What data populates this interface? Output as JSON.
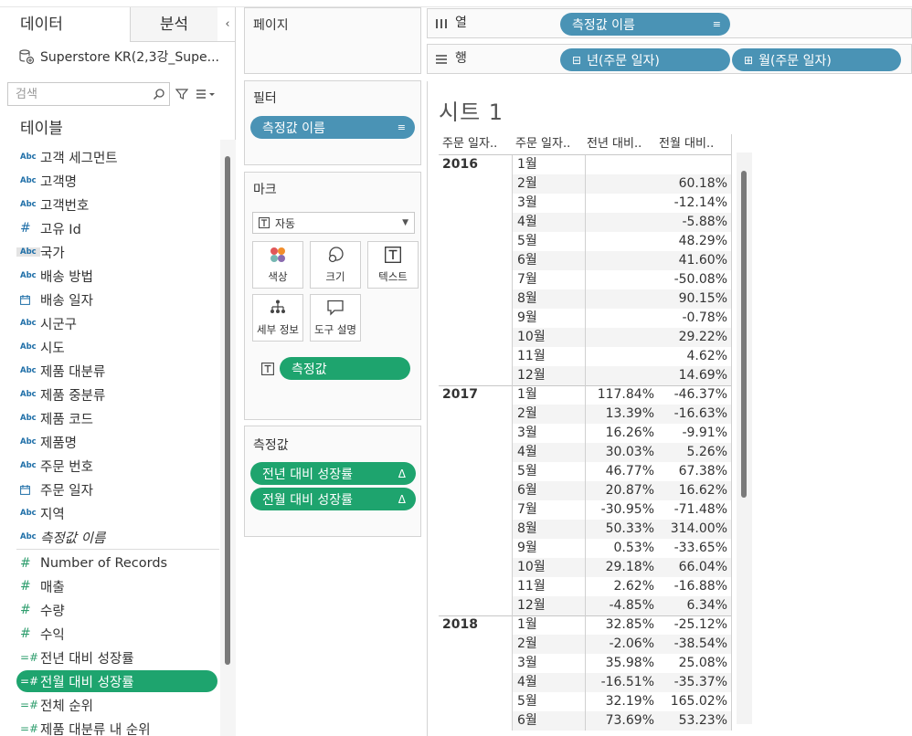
{
  "data_pane": {
    "tab_data": "데이터",
    "tab_analysis": "분석",
    "collapse_glyph": "‹",
    "source_name": "Superstore KR(2,3강_Supe...",
    "search_placeholder": "검색",
    "tables_title": "테이블",
    "dimensions": [
      {
        "type": "Abc",
        "name": "고객 세그먼트"
      },
      {
        "type": "Abc",
        "name": "고객명"
      },
      {
        "type": "Abc",
        "name": "고객번호"
      },
      {
        "type": "#",
        "name": "고유 Id"
      },
      {
        "type": "Abc",
        "name": "국가"
      },
      {
        "type": "Abc",
        "name": "배송 방법"
      },
      {
        "type": "date",
        "name": "배송 일자"
      },
      {
        "type": "Abc",
        "name": "시군구"
      },
      {
        "type": "Abc",
        "name": "시도"
      },
      {
        "type": "Abc",
        "name": "제품 대분류"
      },
      {
        "type": "Abc",
        "name": "제품 중분류"
      },
      {
        "type": "Abc",
        "name": "제품 코드"
      },
      {
        "type": "Abc",
        "name": "제품명"
      },
      {
        "type": "Abc",
        "name": "주문 번호"
      },
      {
        "type": "date",
        "name": "주문 일자"
      },
      {
        "type": "Abc",
        "name": "지역"
      },
      {
        "type": "Abc",
        "name": "측정값 이름"
      }
    ],
    "measures": [
      {
        "type": "#",
        "name": "Number of Records"
      },
      {
        "type": "#",
        "name": "매출"
      },
      {
        "type": "#",
        "name": "수량"
      },
      {
        "type": "#",
        "name": "수익"
      },
      {
        "type": "calc",
        "name": "전년 대비 성장률"
      },
      {
        "type": "calc",
        "name": "전월 대비 성장률"
      },
      {
        "type": "calc",
        "name": "전체 순위"
      },
      {
        "type": "calc",
        "name": "제품 대분류 내 순위"
      }
    ]
  },
  "cards": {
    "pages_title": "페이지",
    "filters_title": "필터",
    "filter_pill": "측정값 이름",
    "marks_title": "마크",
    "mark_type": "자동",
    "mark_buttons": [
      "색상",
      "크기",
      "텍스트",
      "세부 정보",
      "도구 설명"
    ],
    "mark_pill": "측정값",
    "measure_values_title": "측정값",
    "measure_pills": [
      "전년 대비 성장률",
      "전월 대비 성장률"
    ],
    "delta_glyph": "Δ"
  },
  "shelves": {
    "columns_label": "열",
    "rows_label": "행",
    "column_pill": "측정값 이름",
    "row_pills": [
      "년(주문 일자)",
      "월(주문 일자)"
    ]
  },
  "view": {
    "sheet_title": "시트 1",
    "headers": [
      "주문 일자..",
      "주문 일자..",
      "전년 대비..",
      "전월 대비.."
    ],
    "years": [
      {
        "year": "2016",
        "rows": [
          {
            "month": "1월",
            "yoy": "",
            "mom": ""
          },
          {
            "month": "2월",
            "yoy": "",
            "mom": "60.18%"
          },
          {
            "month": "3월",
            "yoy": "",
            "mom": "-12.14%"
          },
          {
            "month": "4월",
            "yoy": "",
            "mom": "-5.88%"
          },
          {
            "month": "5월",
            "yoy": "",
            "mom": "48.29%"
          },
          {
            "month": "6월",
            "yoy": "",
            "mom": "41.60%"
          },
          {
            "month": "7월",
            "yoy": "",
            "mom": "-50.08%"
          },
          {
            "month": "8월",
            "yoy": "",
            "mom": "90.15%"
          },
          {
            "month": "9월",
            "yoy": "",
            "mom": "-0.78%"
          },
          {
            "month": "10월",
            "yoy": "",
            "mom": "29.22%"
          },
          {
            "month": "11월",
            "yoy": "",
            "mom": "4.62%"
          },
          {
            "month": "12월",
            "yoy": "",
            "mom": "14.69%"
          }
        ]
      },
      {
        "year": "2017",
        "rows": [
          {
            "month": "1월",
            "yoy": "117.84%",
            "mom": "-46.37%"
          },
          {
            "month": "2월",
            "yoy": "13.39%",
            "mom": "-16.63%"
          },
          {
            "month": "3월",
            "yoy": "16.26%",
            "mom": "-9.91%"
          },
          {
            "month": "4월",
            "yoy": "30.03%",
            "mom": "5.26%"
          },
          {
            "month": "5월",
            "yoy": "46.77%",
            "mom": "67.38%"
          },
          {
            "month": "6월",
            "yoy": "20.87%",
            "mom": "16.62%"
          },
          {
            "month": "7월",
            "yoy": "-30.95%",
            "mom": "-71.48%"
          },
          {
            "month": "8월",
            "yoy": "50.33%",
            "mom": "314.00%"
          },
          {
            "month": "9월",
            "yoy": "0.53%",
            "mom": "-33.65%"
          },
          {
            "month": "10월",
            "yoy": "29.18%",
            "mom": "66.04%"
          },
          {
            "month": "11월",
            "yoy": "2.62%",
            "mom": "-16.88%"
          },
          {
            "month": "12월",
            "yoy": "-4.85%",
            "mom": "6.34%"
          }
        ]
      },
      {
        "year": "2018",
        "rows": [
          {
            "month": "1월",
            "yoy": "32.85%",
            "mom": "-25.12%"
          },
          {
            "month": "2월",
            "yoy": "-2.06%",
            "mom": "-38.54%"
          },
          {
            "month": "3월",
            "yoy": "35.98%",
            "mom": "25.08%"
          },
          {
            "month": "4월",
            "yoy": "-16.51%",
            "mom": "-35.37%"
          },
          {
            "month": "5월",
            "yoy": "32.19%",
            "mom": "165.02%"
          },
          {
            "month": "6월",
            "yoy": "73.69%",
            "mom": "53.23%"
          }
        ]
      }
    ]
  },
  "colors": {
    "pill_blue": "#4a93b5",
    "pill_green": "#1ea46e"
  }
}
